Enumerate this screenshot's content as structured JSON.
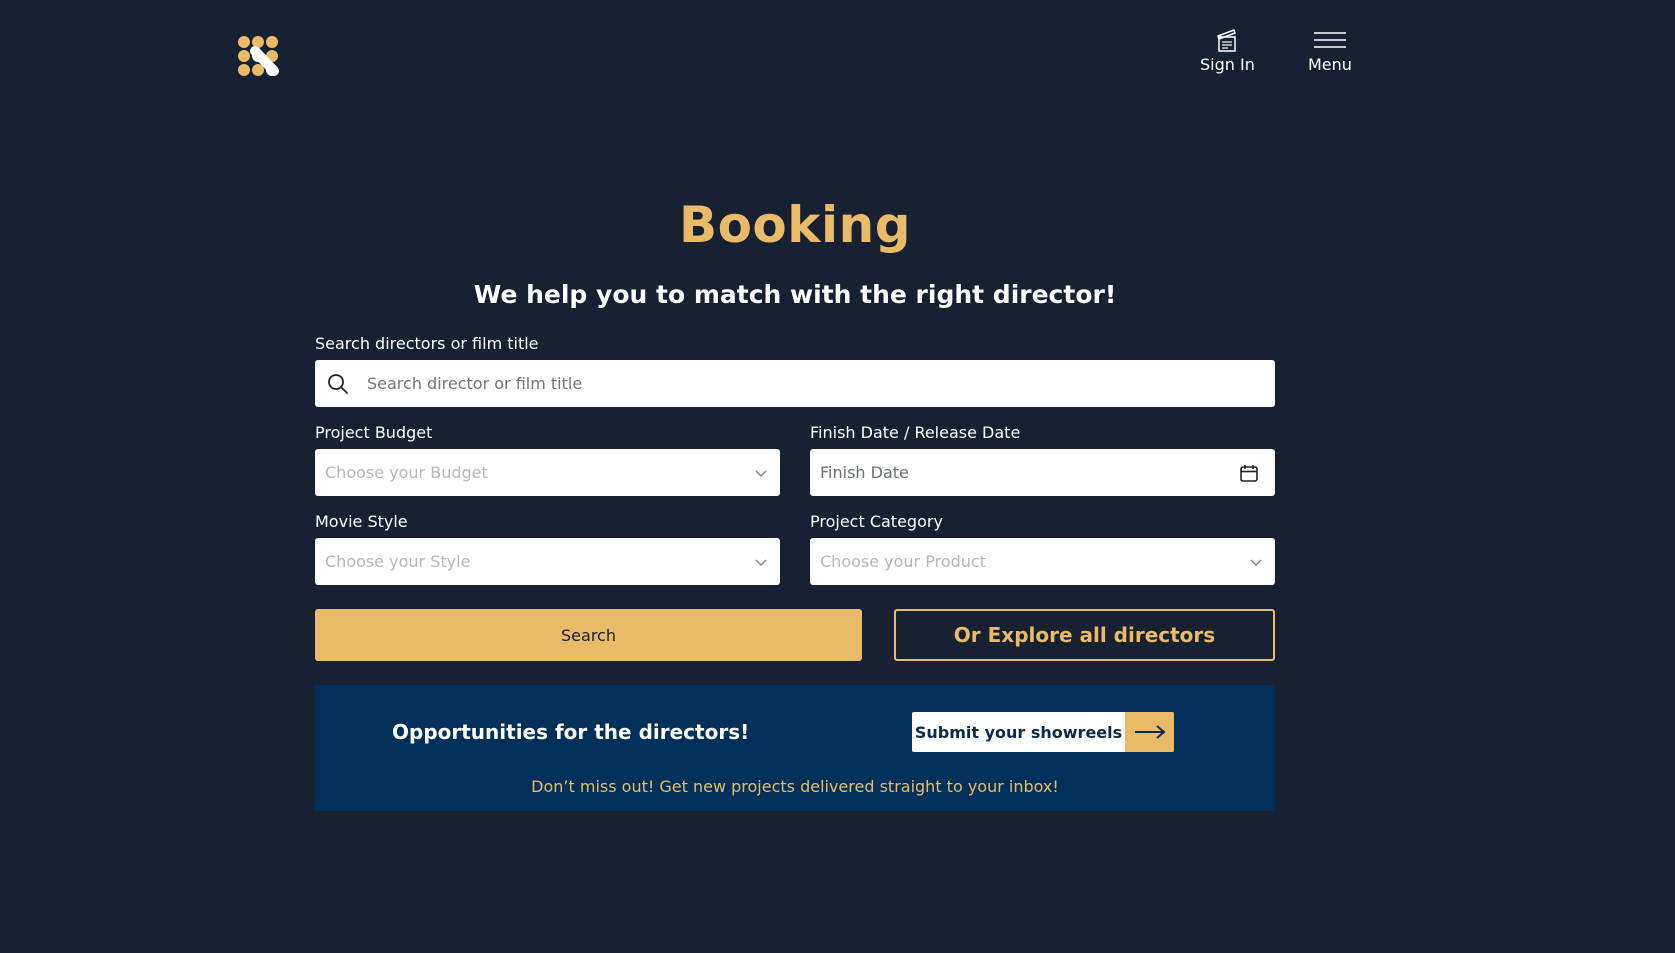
{
  "header": {
    "logo_icon": "dots-logo-icon",
    "sign_in_label": "Sign In",
    "sign_in_icon": "clapperboard-icon",
    "menu_label": "Menu",
    "menu_icon": "hamburger-icon"
  },
  "hero": {
    "title": "Booking",
    "subtitle": "We help you to match with the right director!"
  },
  "form": {
    "search_label": "Search directors or film title",
    "search_placeholder": "Search director or film title",
    "budget_label": "Project Budget",
    "budget_placeholder": "Choose your Budget",
    "date_label": "Finish Date / Release Date",
    "date_placeholder": "Finish Date",
    "style_label": "Movie Style",
    "style_placeholder": "Choose your Style",
    "category_label": "Project Category",
    "category_placeholder": "Choose your Product",
    "search_button": "Search",
    "explore_button": "Or Explore all directors"
  },
  "promo": {
    "title": "Opportunities for the directors!",
    "button_label": "Submit your showreels",
    "note": "Don’t miss out! Get new projects delivered straight to your inbox!"
  },
  "colors": {
    "background": "#172131",
    "accent": "#e9bb68",
    "promo_background": "#01315a"
  }
}
